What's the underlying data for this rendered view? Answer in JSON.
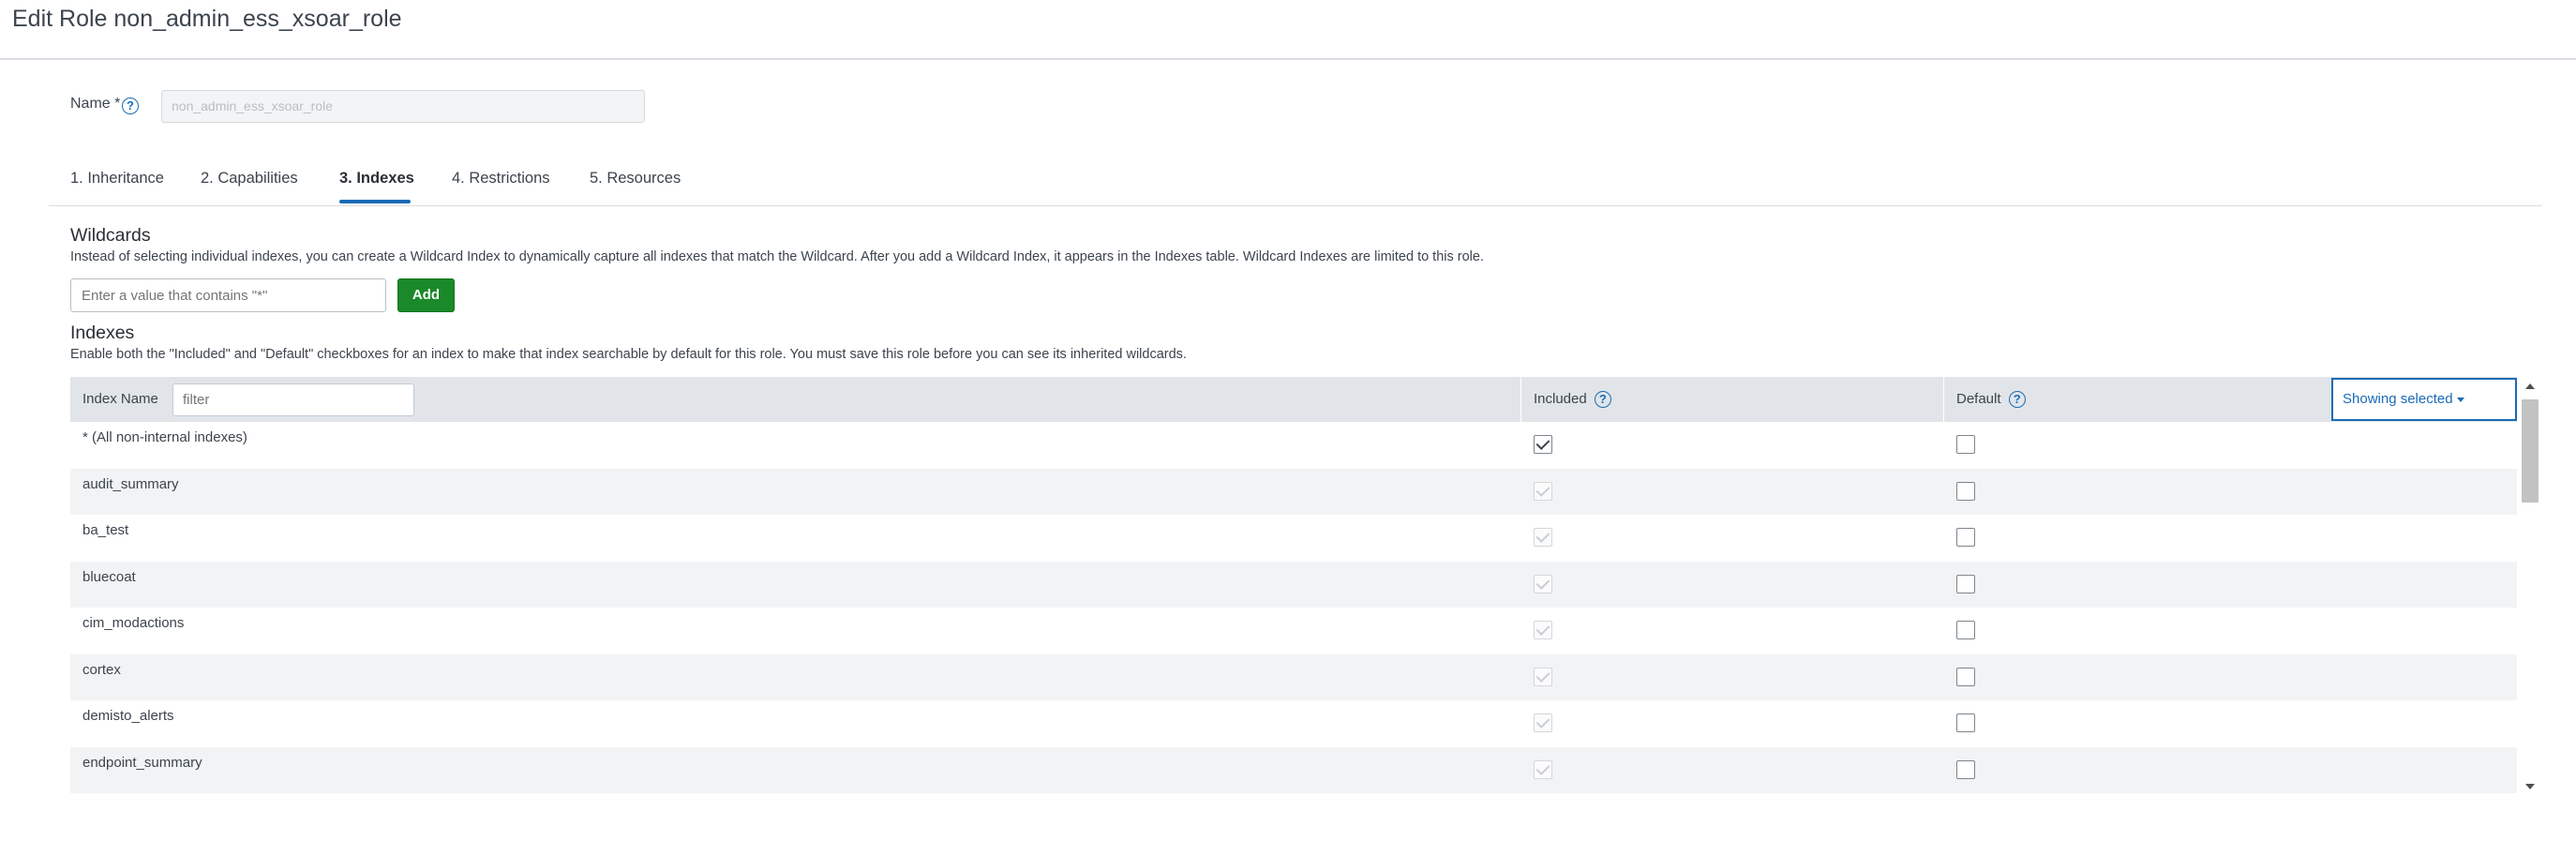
{
  "page": {
    "title": "Edit Role non_admin_ess_xsoar_role"
  },
  "name_field": {
    "label": "Name *",
    "value": "non_admin_ess_xsoar_role",
    "help_icon": "question-circle-icon"
  },
  "tabs": [
    {
      "label": "1. Inheritance",
      "active": false
    },
    {
      "label": "2. Capabilities",
      "active": false
    },
    {
      "label": "3. Indexes",
      "active": true
    },
    {
      "label": "4. Restrictions",
      "active": false
    },
    {
      "label": "5. Resources",
      "active": false
    }
  ],
  "wildcards": {
    "title": "Wildcards",
    "description": "Instead of selecting individual indexes, you can create a Wildcard Index to dynamically capture all indexes that match the Wildcard. After you add a Wildcard Index, it appears in the Indexes table. Wildcard Indexes are limited to this role.",
    "input_placeholder": "Enter a value that contains \"*\"",
    "add_label": "Add"
  },
  "indexes": {
    "title": "Indexes",
    "description": "Enable both the \"Included\" and \"Default\" checkboxes for an index to make that index searchable by default for this role. You must save this role before you can see its inherited wildcards.",
    "columns": {
      "name": "Index Name",
      "included": "Included",
      "default": "Default"
    },
    "filter_placeholder": "filter",
    "showing_label": "Showing selected",
    "rows": [
      {
        "name": "* (All non-internal indexes)",
        "included": true,
        "included_disabled": false,
        "default": false
      },
      {
        "name": "audit_summary",
        "included": true,
        "included_disabled": true,
        "default": false
      },
      {
        "name": "ba_test",
        "included": true,
        "included_disabled": true,
        "default": false
      },
      {
        "name": "bluecoat",
        "included": true,
        "included_disabled": true,
        "default": false
      },
      {
        "name": "cim_modactions",
        "included": true,
        "included_disabled": true,
        "default": false
      },
      {
        "name": "cortex",
        "included": true,
        "included_disabled": true,
        "default": false
      },
      {
        "name": "demisto_alerts",
        "included": true,
        "included_disabled": true,
        "default": false
      },
      {
        "name": "endpoint_summary",
        "included": true,
        "included_disabled": true,
        "default": false
      }
    ]
  },
  "colors": {
    "accent": "#1a6bb5",
    "add_button": "#1a8929",
    "header_bg": "#e1e5e9",
    "row_alt": "#f2f3f5"
  }
}
